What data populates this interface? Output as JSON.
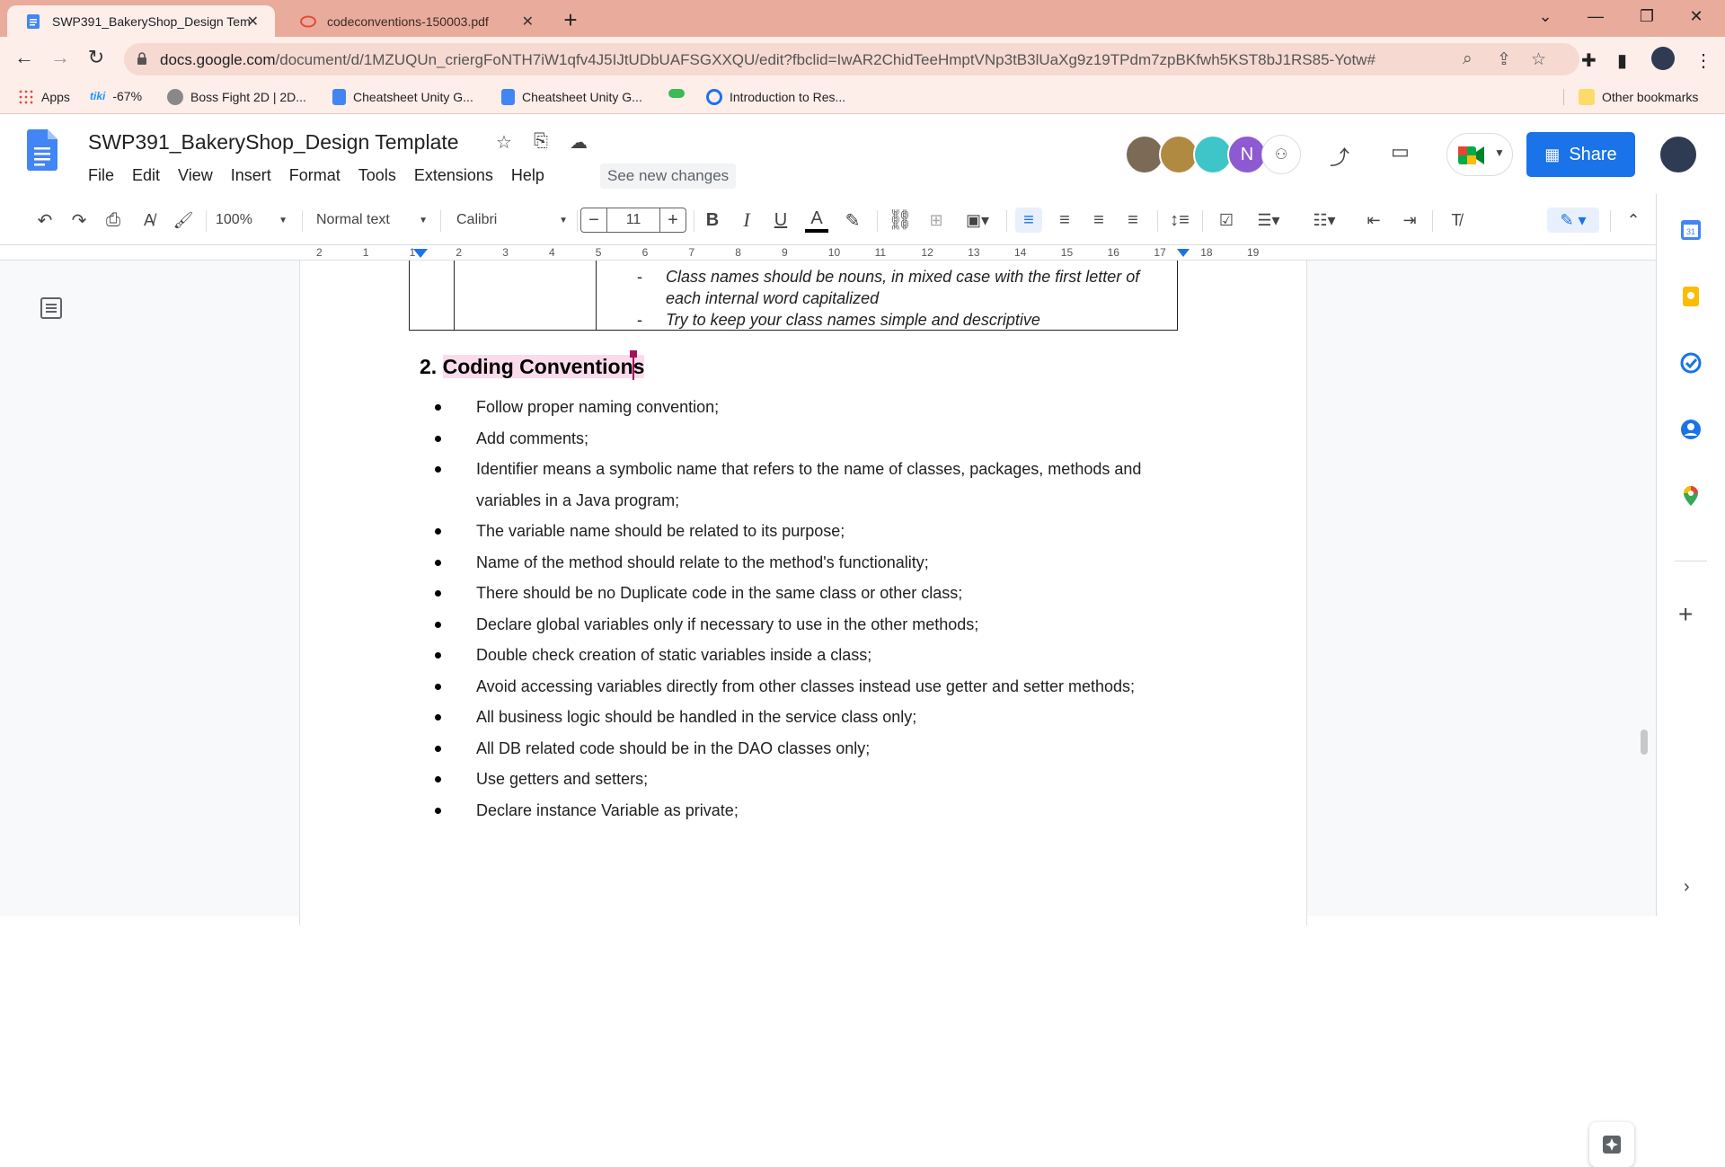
{
  "browser": {
    "tabs": [
      {
        "label": "SWP391_BakeryShop_Design Template",
        "close": "✕"
      },
      {
        "label": "codeconventions-150003.pdf",
        "close": "✕"
      }
    ],
    "new_tab": "+",
    "url_host": "docs.google.com",
    "url_path": "/document/d/1MZUQUn_criergFoNTH7iW1qfv4J5IJtUDbUAFSGXXQU/edit?fbclid=IwAR2ChidTeeHmptVNp3tB3lUaXg9z19TPdm7zpBKfwh5KST8bJ1RS85-Yotw#",
    "bookmarks": [
      "Apps",
      "-67%",
      "Boss Fight 2D | 2D...",
      "Cheatsheet Unity G...",
      "Cheatsheet Unity G...",
      "Introduction to Res...",
      "Other bookmarks"
    ],
    "bookmark_tiki": "tiki"
  },
  "doc": {
    "title": "SWP391_BakeryShop_Design Template",
    "menu": [
      "File",
      "Edit",
      "View",
      "Insert",
      "Format",
      "Tools",
      "Extensions",
      "Help"
    ],
    "see_new_changes": "See new changes",
    "avatar_n": "N",
    "share_label": "Share"
  },
  "toolbar": {
    "zoom": "100%",
    "style": "Normal text",
    "font": "Calibri",
    "font_size": "11",
    "minus": "−",
    "plus": "+",
    "bold": "B",
    "italic": "I",
    "underline": "U",
    "text_color": "A"
  },
  "ruler": {
    "ticks": [
      "2",
      "1",
      "1",
      "2",
      "3",
      "4",
      "5",
      "6",
      "7",
      "8",
      "9",
      "10",
      "11",
      "12",
      "13",
      "14",
      "15",
      "16",
      "17",
      "18",
      "19"
    ]
  },
  "content": {
    "table_lines": [
      "Class names should be nouns, in mixed case with the first letter of",
      "each internal word capitalized",
      "Try to keep your class names simple and descriptive"
    ],
    "dash": "-",
    "heading_number": "2.",
    "heading": "Coding Conventions",
    "bullets": [
      "Follow proper naming convention;",
      "Add comments;",
      "Identifier means a symbolic name that refers to the name of classes, packages, methods and variables in a Java program;",
      "The variable name should be related to its purpose;",
      "Name of the method should relate to the method's functionality;",
      "There should be no Duplicate code in the same class or other class;",
      "Declare global variables only if necessary to use in the other methods;",
      "Double check creation of static variables inside a class;",
      "Avoid accessing variables directly from other classes instead use getter and setter methods;",
      "All business logic should be handled in the service class only;",
      "All DB related code should be in the DAO classes only;",
      "Use getters and setters;",
      "Declare instance Variable as private;"
    ]
  },
  "colors": {
    "tabstrip": "#e9ab9c",
    "accent": "#1a73e8",
    "heading_highlight": "#fadbec",
    "cursor": "#a0145a"
  }
}
